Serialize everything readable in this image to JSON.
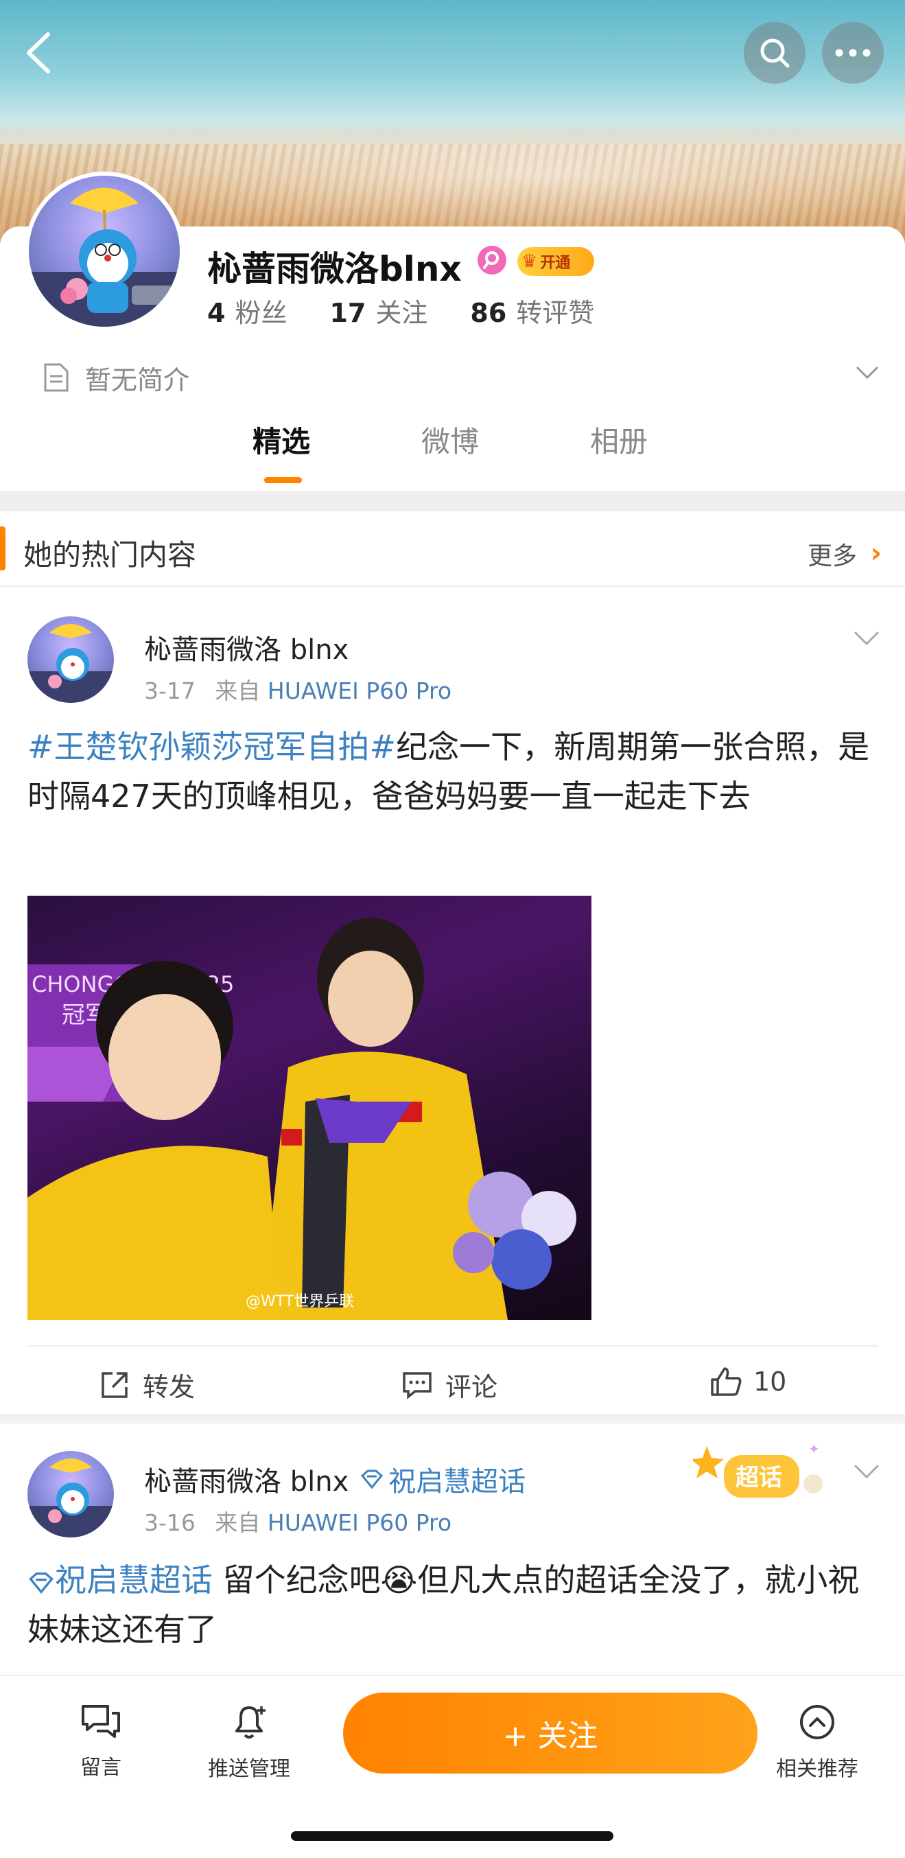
{
  "profile": {
    "name": "杺蔷雨微洛blnx",
    "vip_label": "开通",
    "stats": [
      {
        "num": "4",
        "label": "粉丝"
      },
      {
        "num": "17",
        "label": "关注"
      },
      {
        "num": "86",
        "label": "转评赞"
      }
    ],
    "bio": "暂无简介"
  },
  "tabs": [
    {
      "label": "精选",
      "active": true
    },
    {
      "label": "微博",
      "active": false
    },
    {
      "label": "相册",
      "active": false
    }
  ],
  "section": {
    "title": "她的热门内容",
    "more": "更多"
  },
  "posts": [
    {
      "author": "杺蔷雨微洛 blnx",
      "date": "3-17",
      "from": "来自",
      "source": "HUAWEI P60 Pro",
      "topic": "#王楚钦孙颖莎冠军自拍#",
      "text": "纪念一下，新周期第一张合照，是时隔427天的顶峰相见，爸爸妈妈要一直一起走下去",
      "image_watermark": "@WTT世界乒联",
      "image_banner_text": "CHONGQING 2025",
      "image_banner_text2": "冠军赛2025",
      "actions": {
        "repost": "转发",
        "comment": "评论",
        "like": "10"
      }
    },
    {
      "author": "杺蔷雨微洛 blnx",
      "author_topic": "祝启慧超话",
      "sticker": "超话",
      "date": "3-16",
      "from": "来自",
      "source": "HUAWEI P60 Pro",
      "topic": "祝启慧超话",
      "text_a": " 留个纪念吧",
      "emoji": "😭",
      "text_b": "但凡大点的超话全没了，就小祝妹妹这还有了"
    }
  ],
  "bottom_bar": {
    "message": "留言",
    "push": "推送管理",
    "follow": "+ 关注",
    "related": "相关推荐"
  },
  "colors": {
    "accent": "#ff8200",
    "link": "#3c82c2"
  }
}
